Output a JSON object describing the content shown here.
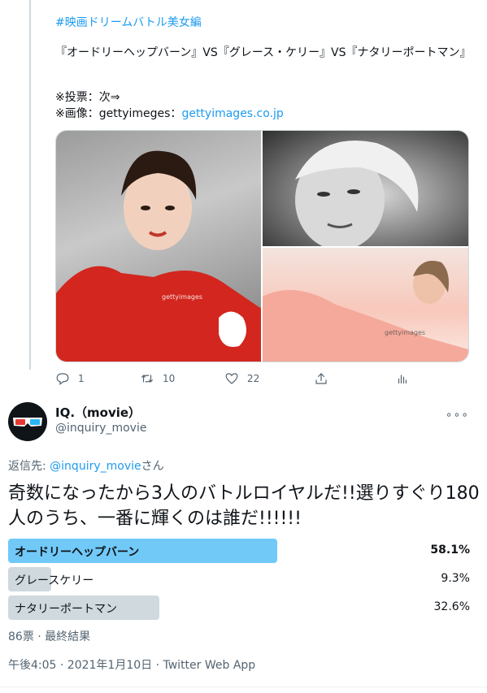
{
  "previous_tweet": {
    "hashtag": "#映画ドリームバトル美女編",
    "body": "『オードリーヘップバーン』VS『グレース・ケリー』VS『ナタリーポートマン』",
    "note_vote": "※投票：次⇒",
    "note_image_prefix": "※画像：gettyimeges：",
    "note_image_link": "gettyimages.co.jp",
    "watermark": "gettyimages",
    "actions": {
      "reply_count": "1",
      "retweet_count": "10",
      "like_count": "22"
    }
  },
  "tweet": {
    "author_name": "IQ.（movie）",
    "author_handle": "@inquiry_movie",
    "reply_prefix": "返信先: ",
    "reply_handle": "@inquiry_movie",
    "reply_suffix": "さん",
    "text": "奇数になったから3人のバトルロイヤルだ!!選りすぐり180人のうち、一番に輝くのは誰だ!!!!!!",
    "poll": {
      "options": [
        {
          "label": "オードリーヘップバーン",
          "percent": "58.1%",
          "fraction": 0.581,
          "color": "#71c9f8",
          "winner": true
        },
        {
          "label": "グレースケリー",
          "percent": "9.3%",
          "fraction": 0.093,
          "color": "#cfd9de",
          "winner": false
        },
        {
          "label": "ナタリーポートマン",
          "percent": "32.6%",
          "fraction": 0.326,
          "color": "#cfd9de",
          "winner": false
        }
      ],
      "meta": "86票 · 最終結果"
    },
    "timestamp": "午後4:05 · 2021年1月10日 · Twitter Web App"
  },
  "colors": {
    "accent": "#1d9bf0",
    "muted": "#536471"
  }
}
